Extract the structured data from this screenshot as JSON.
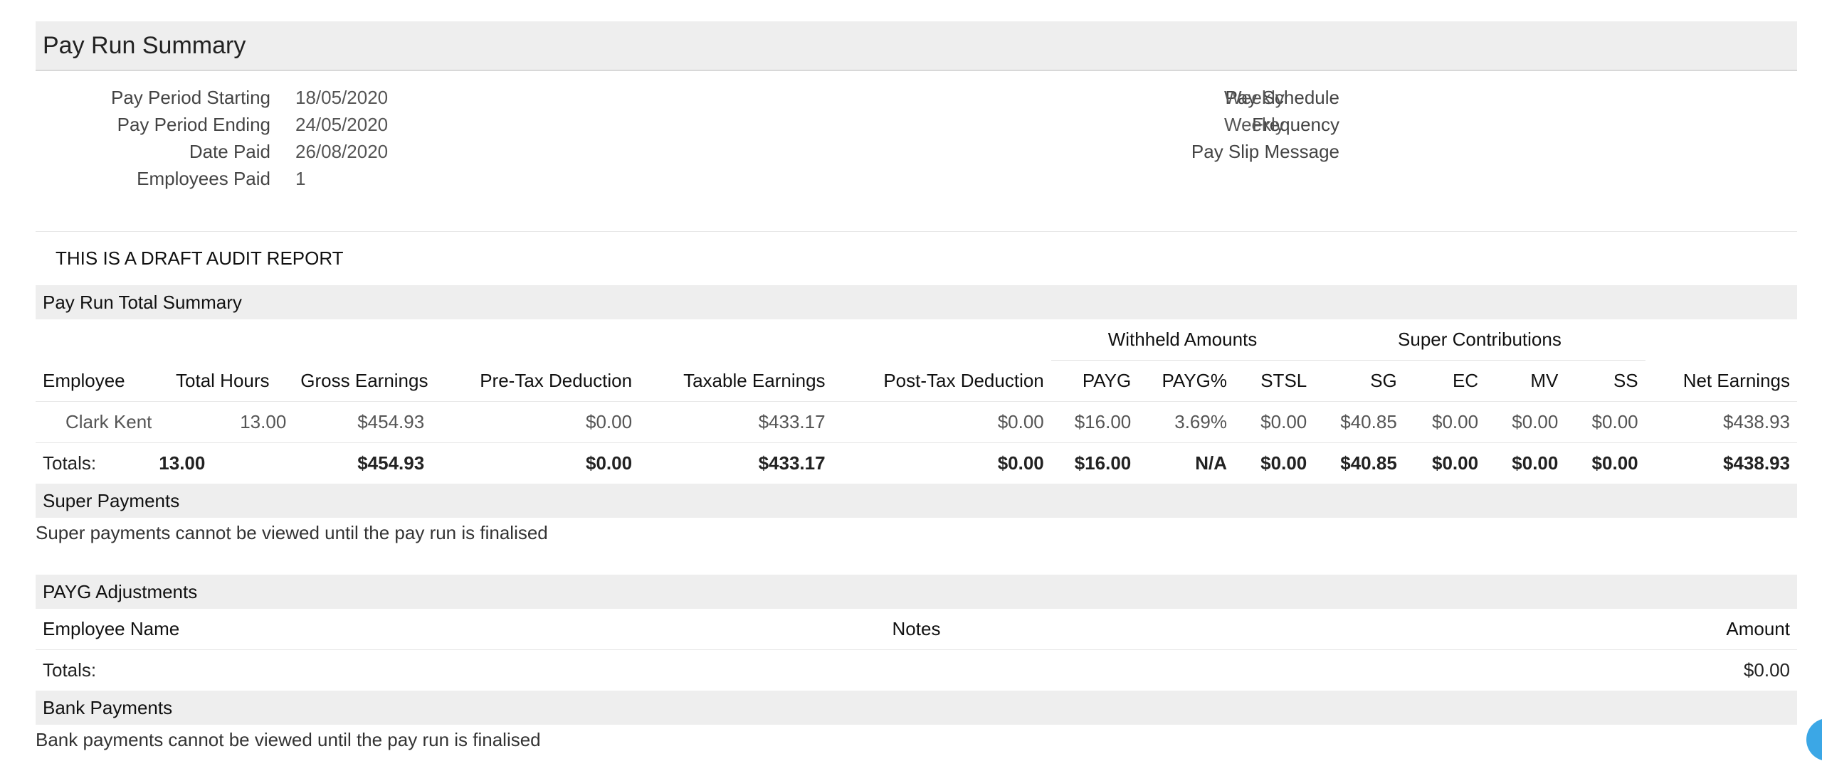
{
  "header": {
    "title": "Pay Run Summary"
  },
  "meta": {
    "left": [
      {
        "label": "Pay Period Starting",
        "value": "18/05/2020"
      },
      {
        "label": "Pay Period Ending",
        "value": "24/05/2020"
      },
      {
        "label": "Date Paid",
        "value": "26/08/2020"
      },
      {
        "label": "Employees Paid",
        "value": "1"
      }
    ],
    "right": [
      {
        "label": "Pay Schedule",
        "value": "Weekly"
      },
      {
        "label": "Frequency",
        "value": "Weekly"
      },
      {
        "label": "Pay Slip Message",
        "value": ""
      }
    ]
  },
  "draft_notice": "THIS IS A DRAFT AUDIT REPORT",
  "summary": {
    "section_title": "Pay Run Total Summary",
    "groups": {
      "withheld": "Withheld Amounts",
      "super": "Super Contributions"
    },
    "columns": {
      "employee": "Employee",
      "hours": "Total Hours",
      "gross": "Gross Earnings",
      "pretax": "Pre-Tax Deduction",
      "taxable": "Taxable Earnings",
      "posttax": "Post-Tax Deduction",
      "payg": "PAYG",
      "paygpct": "PAYG%",
      "stsl": "STSL",
      "sg": "SG",
      "ec": "EC",
      "mv": "MV",
      "ss": "SS",
      "net": "Net Earnings"
    },
    "rows": [
      {
        "employee": "Clark Kent",
        "hours": "13.00",
        "gross": "$454.93",
        "pretax": "$0.00",
        "taxable": "$433.17",
        "posttax": "$0.00",
        "payg": "$16.00",
        "paygpct": "3.69%",
        "stsl": "$0.00",
        "sg": "$40.85",
        "ec": "$0.00",
        "mv": "$0.00",
        "ss": "$0.00",
        "net": "$438.93"
      }
    ],
    "totals": {
      "label": "Totals:",
      "hours": "13.00",
      "gross": "$454.93",
      "pretax": "$0.00",
      "taxable": "$433.17",
      "posttax": "$0.00",
      "payg": "$16.00",
      "paygpct": "N/A",
      "stsl": "$0.00",
      "sg": "$40.85",
      "ec": "$0.00",
      "mv": "$0.00",
      "ss": "$0.00",
      "net": "$438.93"
    }
  },
  "super_payments": {
    "section_title": "Super Payments",
    "message": "Super payments cannot be viewed until the pay run is finalised"
  },
  "payg_adjustments": {
    "section_title": "PAYG Adjustments",
    "columns": {
      "employee_name": "Employee Name",
      "notes": "Notes",
      "amount": "Amount"
    },
    "totals": {
      "label": "Totals:",
      "amount": "$0.00"
    }
  },
  "bank_payments": {
    "section_title": "Bank Payments",
    "message": "Bank payments cannot be viewed until the pay run is finalised"
  }
}
